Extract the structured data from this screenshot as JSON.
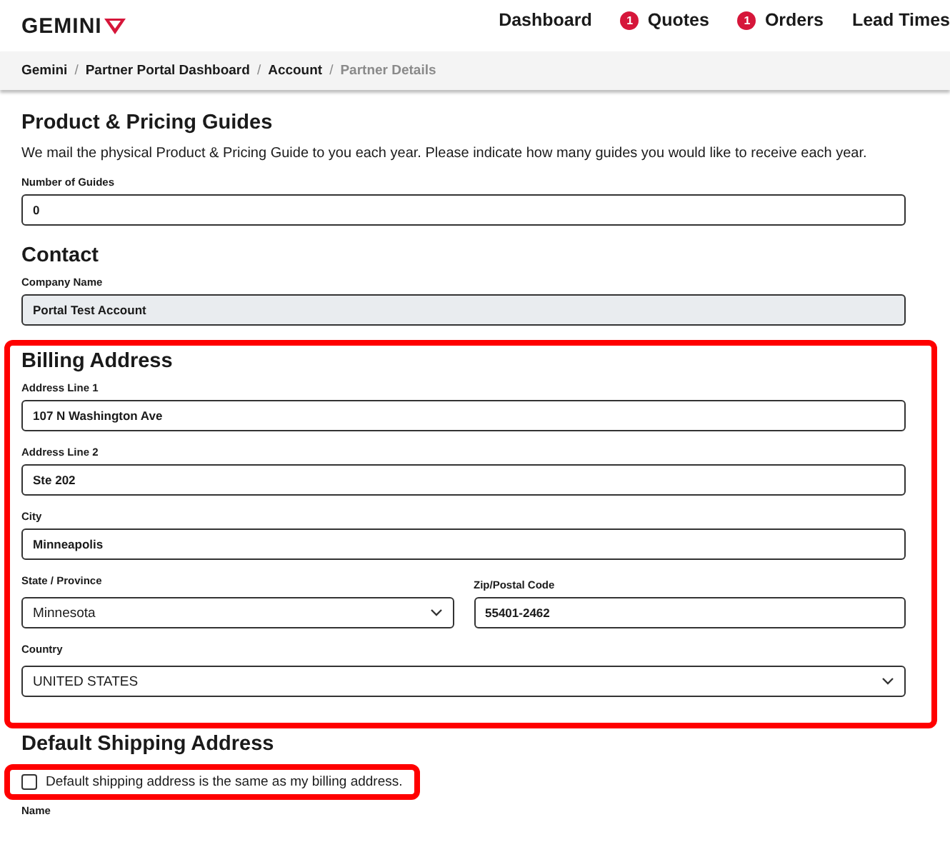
{
  "header": {
    "logo": "GEMINI",
    "nav": [
      {
        "label": "Dashboard"
      },
      {
        "label": "Quotes",
        "badge": "1"
      },
      {
        "label": "Orders",
        "badge": "1"
      },
      {
        "label": "Lead Times"
      }
    ]
  },
  "breadcrumb_separator": "/",
  "breadcrumbs": [
    {
      "label": "Gemini",
      "current": false
    },
    {
      "label": "Partner Portal Dashboard",
      "current": false
    },
    {
      "label": "Account",
      "current": false
    },
    {
      "label": "Partner Details",
      "current": true
    }
  ],
  "sections": [
    {
      "title": "Product & Pricing Guides",
      "highlighted": false,
      "description": "We mail the physical Product & Pricing Guide to you each year. Please indicate how many guides you would like to receive each year.",
      "rows": [
        [
          {
            "label": "Number of Guides",
            "value": "0",
            "kind": "input"
          }
        ]
      ]
    },
    {
      "title": "Contact",
      "highlighted": false,
      "rows": [
        [
          {
            "label": "Company Name",
            "value": "Portal Test Account",
            "kind": "input",
            "disabled": true
          }
        ]
      ]
    },
    {
      "title": "Billing Address",
      "highlighted": true,
      "rows": [
        [
          {
            "label": "Address Line 1",
            "value": "107 N Washington Ave",
            "kind": "input"
          }
        ],
        [
          {
            "label": "Address Line 2",
            "value": "Ste 202",
            "kind": "input"
          }
        ],
        [
          {
            "label": "City",
            "value": "Minneapolis",
            "kind": "input"
          }
        ],
        [
          {
            "label": "State / Province",
            "value": "Minnesota",
            "kind": "select"
          },
          {
            "label": "Zip/Postal Code",
            "value": "55401-2462",
            "kind": "input"
          }
        ],
        [
          {
            "label": "Country",
            "value": "UNITED STATES",
            "kind": "select"
          }
        ]
      ]
    },
    {
      "title": "Default Shipping Address",
      "highlighted": false,
      "checkbox": {
        "label": "Default shipping address is the same as my billing address.",
        "checked": false,
        "highlighted": true
      },
      "trailing_label": "Name"
    }
  ]
}
